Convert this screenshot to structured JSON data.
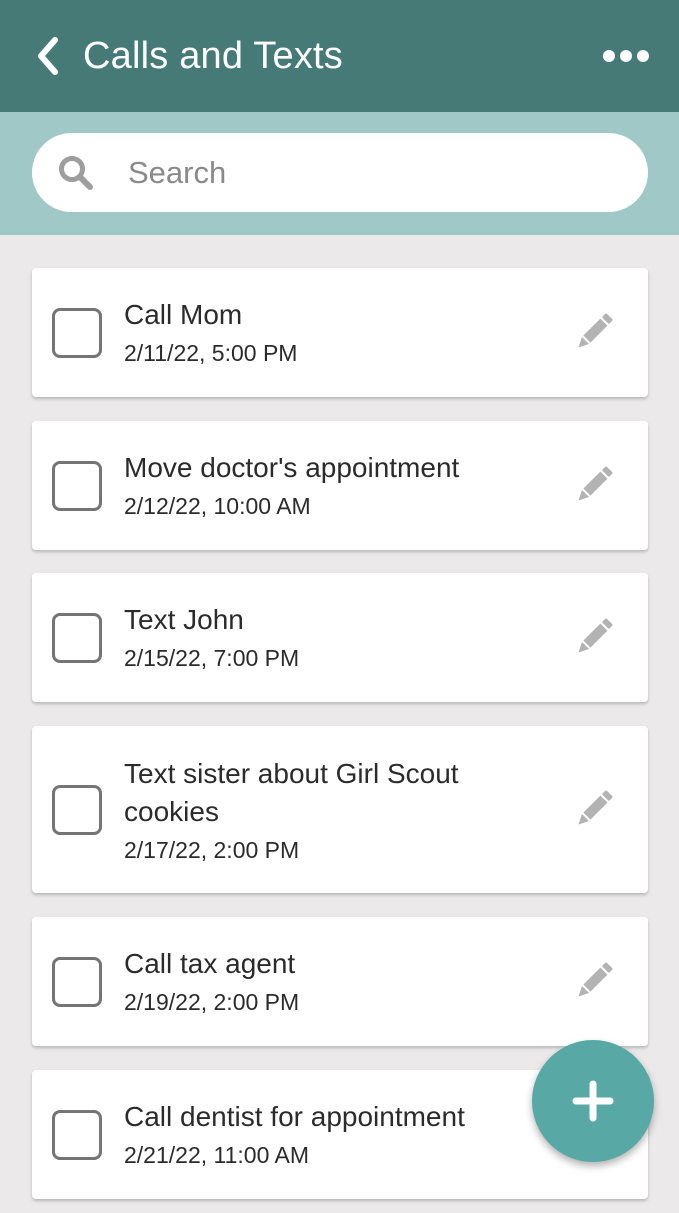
{
  "header": {
    "title": "Calls and Texts",
    "back_icon": "chevron-left-icon",
    "more_icon": "more-horizontal-icon"
  },
  "search": {
    "placeholder": "Search",
    "value": "",
    "icon": "search-icon"
  },
  "tasks": [
    {
      "title": "Call Mom",
      "time": "2/11/22, 5:00 PM",
      "checked": false
    },
    {
      "title": "Move doctor's appointment",
      "time": "2/12/22, 10:00 AM",
      "checked": false
    },
    {
      "title": "Text John",
      "time": "2/15/22, 7:00 PM",
      "checked": false
    },
    {
      "title": "Text sister about Girl Scout cookies",
      "time": "2/17/22, 2:00 PM",
      "checked": false
    },
    {
      "title": "Call tax agent",
      "time": "2/19/22, 2:00 PM",
      "checked": false
    },
    {
      "title": "Call dentist for appointment",
      "time": "2/21/22, 11:00 AM",
      "checked": false
    }
  ],
  "fab": {
    "icon": "plus-icon"
  },
  "colors": {
    "header_bg": "#467a77",
    "search_band_bg": "#a0c8c6",
    "page_bg": "#ebe9ea",
    "fab_bg": "#58a9a6",
    "edit_icon": "#b3b3b3"
  }
}
